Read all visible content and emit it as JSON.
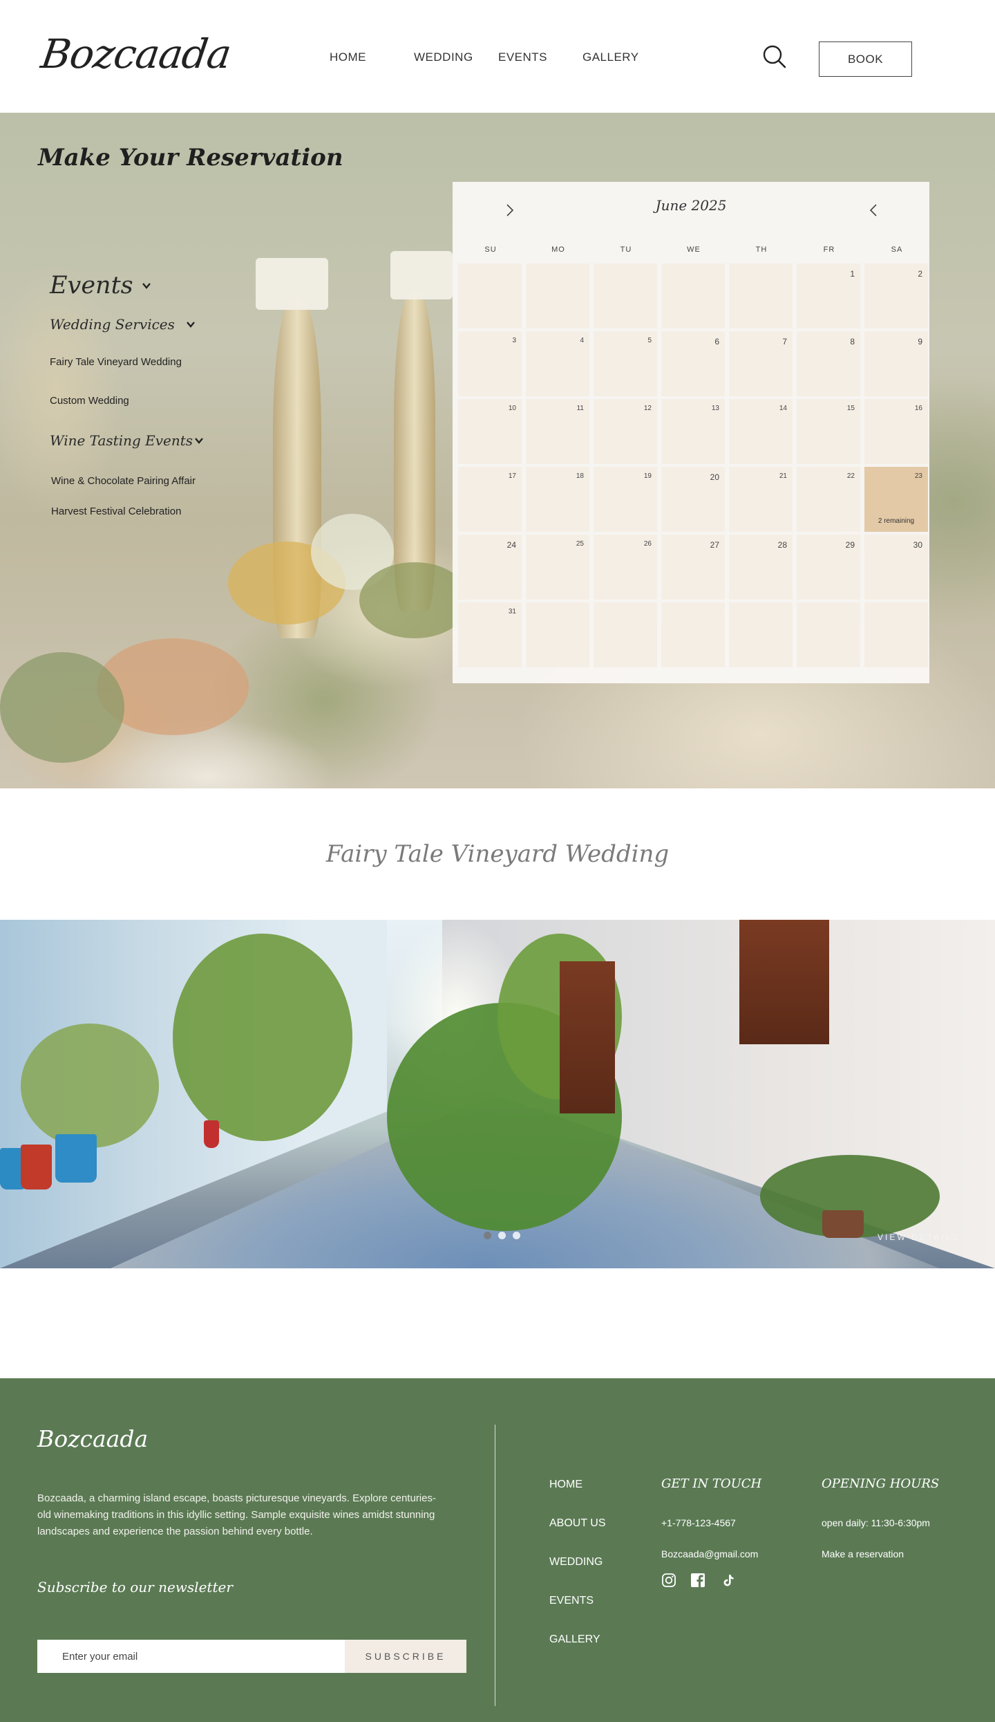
{
  "header": {
    "logo": "Bozcaada",
    "nav": [
      "HOME",
      "WEDDING",
      "EVENTS",
      "GALLERY"
    ],
    "search_icon": "search-icon",
    "book_label": "BOOK"
  },
  "reservation": {
    "title": "Make Your Reservation",
    "menu": {
      "events_label": "Events",
      "wedding_services_label": "Wedding Services",
      "wedding_items": [
        "Fairy Tale Vineyard Wedding",
        "Custom Wedding"
      ],
      "wine_tasting_label": "Wine Tasting Events",
      "wine_items": [
        "Wine & Chocolate Pairing Affair",
        "Harvest Festival Celebration"
      ]
    },
    "calendar": {
      "month": "June 2025",
      "weekdays": [
        "SU",
        "MO",
        "TU",
        "WE",
        "TH",
        "FR",
        "SA"
      ],
      "weeks": [
        [
          "",
          "",
          "",
          "",
          "",
          "1",
          "2"
        ],
        [
          "3",
          "4",
          "5",
          "6",
          "7",
          "8",
          "9"
        ],
        [
          "10",
          "11",
          "12",
          "13",
          "14",
          "15",
          "16"
        ],
        [
          "17",
          "18",
          "19",
          "20",
          "21",
          "22",
          "23"
        ],
        [
          "24",
          "25",
          "26",
          "27",
          "28",
          "29",
          "30"
        ],
        [
          "31",
          "",
          "",
          "",
          "",
          "",
          ""
        ]
      ],
      "selected_day": "23",
      "selected_note": "2 remaining",
      "selected_color": "#e3c9a6"
    }
  },
  "featured": {
    "title": "Fairy Tale Vineyard Wedding",
    "slides_total": 3,
    "active_slide": 1,
    "view_details": "VIEW DETAILS"
  },
  "footer": {
    "brand": "Bozcaada",
    "description": "Bozcaada, a charming island escape, boasts picturesque vineyards. Explore centuries-old winemaking traditions in this idyllic setting. Sample exquisite wines amidst stunning landscapes and experience the passion behind every bottle.",
    "newsletter_title": "Subscribe to our newsletter",
    "email_placeholder": "Enter your email",
    "subscribe_label": "SUBSCRIBE",
    "links": [
      "HOME",
      "ABOUT US",
      "WEDDING",
      "EVENTS",
      "GALLERY"
    ],
    "contact_title": "GET IN TOUCH",
    "phone": "+1-778-123-4567",
    "email": "Bozcaada@gmail.com",
    "social": [
      "instagram-icon",
      "facebook-icon",
      "tiktok-icon"
    ],
    "hours_title": "OPENING HOURS",
    "hours": "open daily: 11:30-6:30pm",
    "reservation_link": "Make a reservation",
    "background_color": "#5b7a54"
  }
}
